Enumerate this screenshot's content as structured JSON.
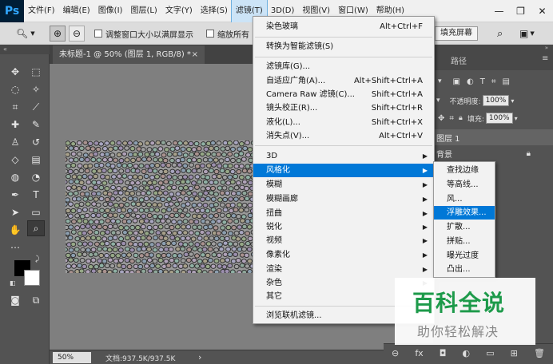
{
  "app": {
    "logo": "Ps"
  },
  "menubar": {
    "items": [
      "文件(F)",
      "编辑(E)",
      "图像(I)",
      "图层(L)",
      "文字(Y)",
      "选择(S)",
      "滤镜(T)",
      "3D(D)",
      "视图(V)",
      "窗口(W)",
      "帮助(H)"
    ],
    "active": "滤镜(T)"
  },
  "window_controls": {
    "minimize": "—",
    "restore": "❐",
    "close": "✕"
  },
  "options_bar": {
    "zoom_tool": "🔍︎",
    "zoom_in": "⊕",
    "zoom_out": "⊖",
    "resize_window_label": "调整窗口大小以满屏显示",
    "zoom_all_label": "缩放所有",
    "fill_screen_button": "填充屏幕"
  },
  "document": {
    "tab_title": "未标题-1 @ 50% (图层 1, RGB/8) *",
    "tab_close": "×",
    "zoom": "50%",
    "doc_info": "文档:937.5K/937.5K",
    "status_arrow": "›"
  },
  "filter_menu": {
    "items": [
      {
        "label": "染色玻璃",
        "shortcut": "Alt+Ctrl+F"
      },
      {
        "label": "转换为智能滤镜(S)",
        "shortcut": ""
      },
      {
        "label": "滤镜库(G)...",
        "shortcut": ""
      },
      {
        "label": "自适应广角(A)...",
        "shortcut": "Alt+Shift+Ctrl+A"
      },
      {
        "label": "Camera Raw 滤镜(C)...",
        "shortcut": "Shift+Ctrl+A"
      },
      {
        "label": "镜头校正(R)...",
        "shortcut": "Shift+Ctrl+R"
      },
      {
        "label": "液化(L)...",
        "shortcut": "Shift+Ctrl+X"
      },
      {
        "label": "消失点(V)...",
        "shortcut": "Alt+Ctrl+V"
      }
    ],
    "groups": [
      {
        "label": "3D",
        "has_submenu": true
      },
      {
        "label": "风格化",
        "has_submenu": true,
        "highlighted": true
      },
      {
        "label": "模糊",
        "has_submenu": true
      },
      {
        "label": "模糊画廊",
        "has_submenu": true
      },
      {
        "label": "扭曲",
        "has_submenu": true
      },
      {
        "label": "锐化",
        "has_submenu": true
      },
      {
        "label": "视频",
        "has_submenu": true
      },
      {
        "label": "像素化",
        "has_submenu": true
      },
      {
        "label": "渲染",
        "has_submenu": true
      },
      {
        "label": "杂色",
        "has_submenu": true
      },
      {
        "label": "其它",
        "has_submenu": true
      }
    ],
    "browse_online": "浏览联机滤镜..."
  },
  "stylize_submenu": {
    "items": [
      "查找边缘",
      "等高线...",
      "风...",
      "浮雕效果...",
      "扩散...",
      "拼贴...",
      "曝光过度",
      "凸出..."
    ],
    "highlighted": "浮雕效果..."
  },
  "panels": {
    "tab": "路径",
    "opacity_label": "不透明度:",
    "opacity_value": "100%",
    "fill_label": "填充:",
    "fill_value": "100%",
    "layers": [
      {
        "name": "图层 1",
        "selected": true
      },
      {
        "name": "背景",
        "locked": true
      }
    ],
    "lock_icon": "🔒︎",
    "bottom_icons": [
      "⊖",
      "fx",
      "◘",
      "◐",
      "▭",
      "⊞",
      "🗑︎"
    ]
  },
  "watermark": {
    "logo_text": "百科全说",
    "tagline": "助你轻松解决"
  },
  "colors": {
    "menu_highlight": "#0078d7",
    "watermark_green": "#1d9a4a",
    "foreground": "#000000",
    "background": "#ffffff"
  }
}
